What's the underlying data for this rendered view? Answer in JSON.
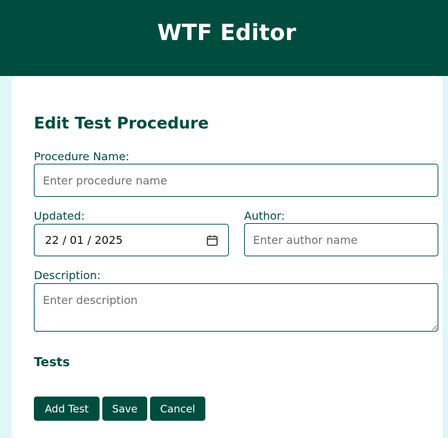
{
  "header": {
    "title": "WTF Editor"
  },
  "form": {
    "title": "Edit Test Procedure",
    "procedure_name": {
      "label": "Procedure Name:",
      "placeholder": "Enter procedure name",
      "value": ""
    },
    "updated": {
      "label": "Updated:",
      "value": "22 / 01 / 2025",
      "icon": "calendar-icon"
    },
    "author": {
      "label": "Author:",
      "placeholder": "Enter author name",
      "value": ""
    },
    "description": {
      "label": "Description:",
      "placeholder": "Enter description",
      "value": ""
    },
    "tests_heading": "Tests"
  },
  "buttons": {
    "add_test": "Add Test",
    "save": "Save",
    "cancel": "Cancel"
  },
  "colors": {
    "primary": "#004d40",
    "background": "#e0f7f7",
    "card": "#ffffff"
  }
}
